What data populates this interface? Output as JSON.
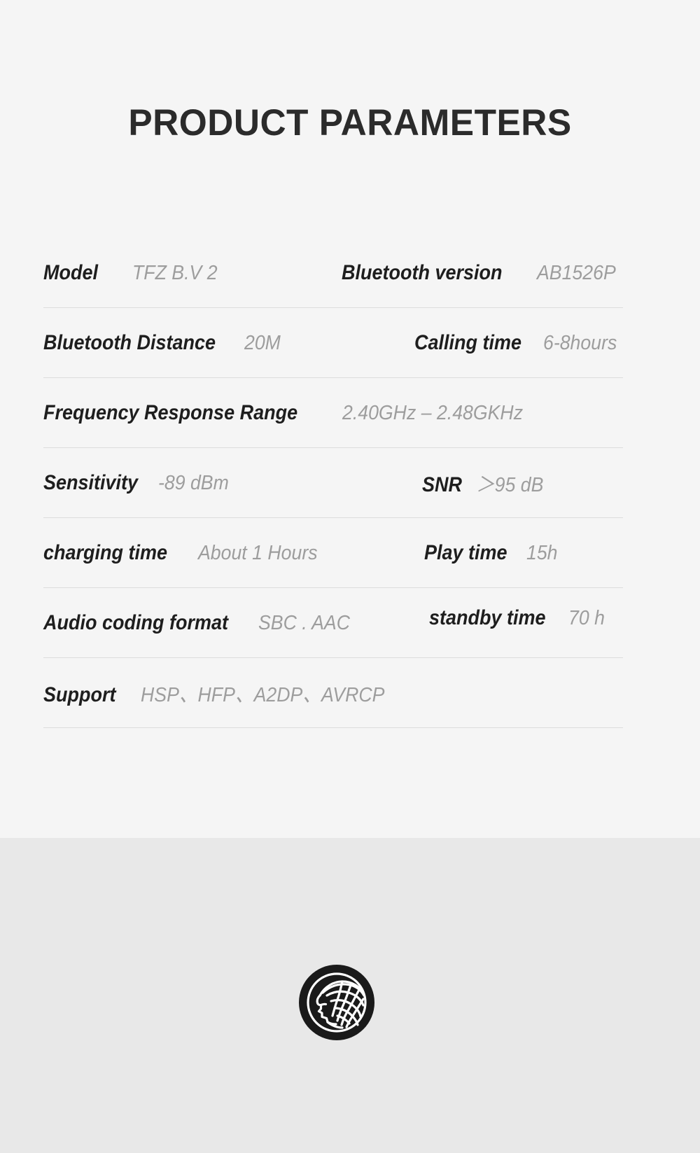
{
  "header": {
    "title": "PRODUCT PARAMETERS"
  },
  "colors": {
    "section_background": "#f5f5f5",
    "footer_background": "#e8e8e8",
    "label_text": "#1e1e1e",
    "value_text": "#9d9d9d",
    "separator": "#dcdcdc",
    "logo": "#1a1a1a"
  },
  "spec_rows": [
    {
      "left": {
        "label": "Model",
        "value": "TFZ B.V 2"
      },
      "right": {
        "label": "Bluetooth version",
        "value": "AB1526P"
      }
    },
    {
      "left": {
        "label": "Bluetooth Distance",
        "value": "20M"
      },
      "right": {
        "label": "Calling time",
        "value": "6-8hours"
      }
    },
    {
      "left": {
        "label": "Frequency Response Range",
        "value": "2.40GHz – 2.48GKHz"
      },
      "right": null
    },
    {
      "left": {
        "label": "Sensitivity",
        "value": "-89 dBm"
      },
      "right": {
        "label": "SNR",
        "value": "＞95 dB"
      }
    },
    {
      "left": {
        "label": "charging time",
        "value": "About 1 Hours"
      },
      "right": {
        "label": "Play time",
        "value": "15h"
      }
    },
    {
      "left": {
        "label": "Audio coding format",
        "value": "SBC . AAC"
      },
      "right": {
        "label": "standby time",
        "value": "70 h"
      }
    },
    {
      "left": {
        "label": "Support",
        "value": "HSP、HFP、A2DP、AVRCP"
      },
      "right": null
    }
  ],
  "footer": {
    "logo_name": "tfz-brand-logo"
  }
}
